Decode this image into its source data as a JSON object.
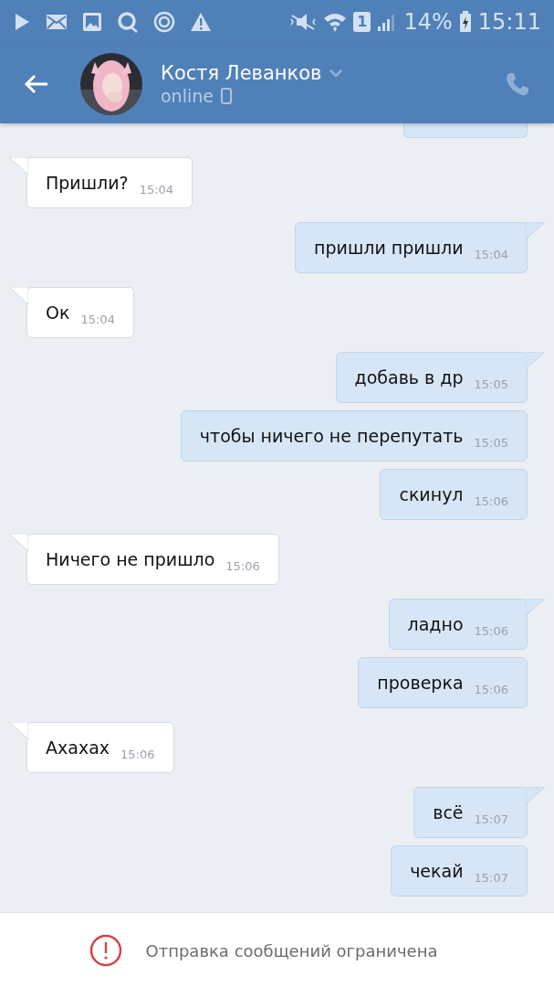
{
  "status_bar": {
    "sim": "1",
    "battery": "14%",
    "time": "15:11"
  },
  "header": {
    "name": "Костя Леванков",
    "status": "online"
  },
  "messages": [
    {
      "kind": "outgoing",
      "clipped": true
    },
    {
      "kind": "incoming",
      "text": "Пришли?",
      "time": "15:04"
    },
    {
      "kind": "outgoing",
      "text": "пришли пришли",
      "time": "15:04"
    },
    {
      "kind": "incoming",
      "text": "Ок",
      "time": "15:04"
    },
    {
      "kind": "outgoing",
      "text": "добавь в др",
      "time": "15:05"
    },
    {
      "kind": "outgoing",
      "text": "чтобы ничего не перепутать",
      "time": "15:05"
    },
    {
      "kind": "outgoing",
      "text": "скинул",
      "time": "15:06"
    },
    {
      "kind": "incoming",
      "text": "Ничего не пришло",
      "time": "15:06"
    },
    {
      "kind": "outgoing",
      "text": "ладно",
      "time": "15:06"
    },
    {
      "kind": "outgoing",
      "text": "проверка",
      "time": "15:06"
    },
    {
      "kind": "incoming",
      "text": "Ахахах",
      "time": "15:06"
    },
    {
      "kind": "outgoing",
      "text": "всё",
      "time": "15:07"
    },
    {
      "kind": "outgoing",
      "text": "чекай",
      "time": "15:07"
    }
  ],
  "notice": {
    "text": "Отправка сообщений ограничена"
  }
}
